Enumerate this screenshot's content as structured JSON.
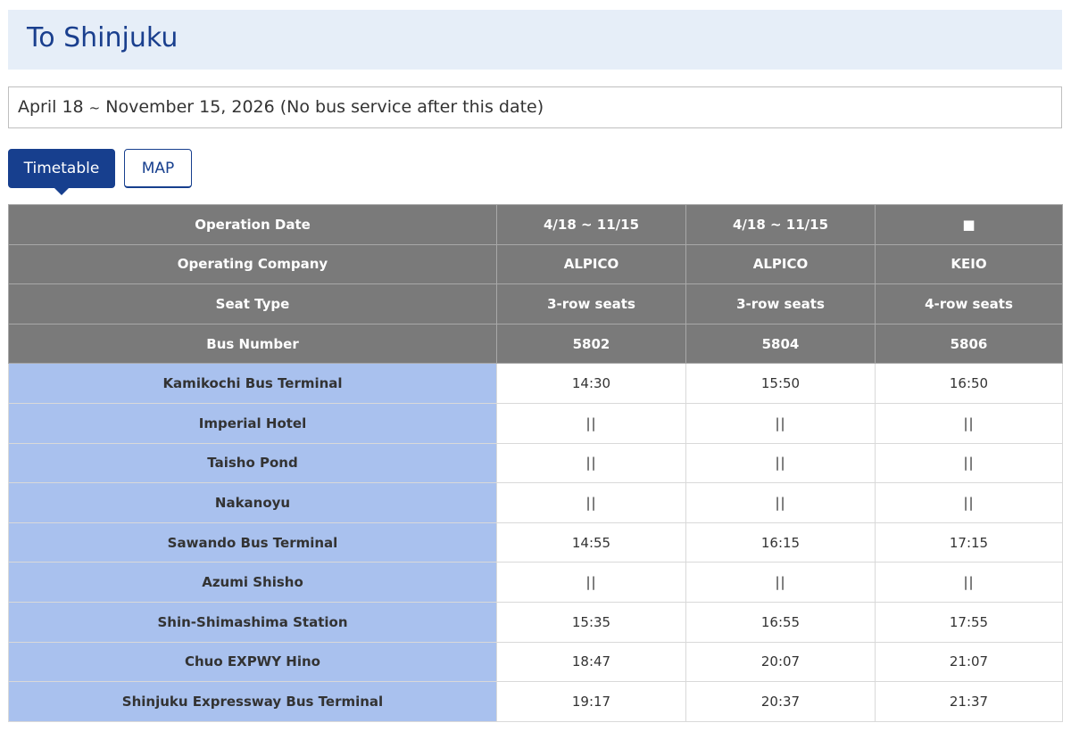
{
  "page": {
    "title": "To Shinjuku",
    "period": {
      "start": "April 18",
      "tilde": "~",
      "end_text": "November 15, 2026 (No bus service after this date)"
    },
    "tabs": [
      {
        "label": "Timetable",
        "active": true
      },
      {
        "label": "MAP",
        "active": false
      }
    ]
  },
  "colors": {
    "accent": "#173f8e",
    "header_bg": "#e6eef8",
    "table_head_bg": "#7a7a7a",
    "stop_bg": "#a9c1ee"
  },
  "table": {
    "header_rows": [
      {
        "label": "Operation Date",
        "values": [
          "4/18 ~ 11/15",
          "4/18 ~ 11/15",
          "■"
        ]
      },
      {
        "label": "Operating Company",
        "values": [
          "ALPICO",
          "ALPICO",
          "KEIO"
        ]
      },
      {
        "label": "Seat Type",
        "values": [
          "3-row seats",
          "3-row seats",
          "4-row seats"
        ]
      },
      {
        "label": "Bus Number",
        "values": [
          "5802",
          "5804",
          "5806"
        ]
      }
    ],
    "stops": [
      {
        "name": "Kamikochi Bus Terminal",
        "times": [
          "14:30",
          "15:50",
          "16:50"
        ]
      },
      {
        "name": "Imperial Hotel",
        "times": [
          "||",
          "||",
          "||"
        ]
      },
      {
        "name": "Taisho Pond",
        "times": [
          "||",
          "||",
          "||"
        ]
      },
      {
        "name": "Nakanoyu",
        "times": [
          "||",
          "||",
          "||"
        ]
      },
      {
        "name": "Sawando Bus Terminal",
        "times": [
          "14:55",
          "16:15",
          "17:15"
        ]
      },
      {
        "name": "Azumi Shisho",
        "times": [
          "||",
          "||",
          "||"
        ]
      },
      {
        "name": "Shin-Shimashima Station",
        "times": [
          "15:35",
          "16:55",
          "17:55"
        ]
      },
      {
        "name": "Chuo EXPWY Hino",
        "times": [
          "18:47",
          "20:07",
          "21:07"
        ]
      },
      {
        "name": "Shinjuku Expressway Bus Terminal",
        "times": [
          "19:17",
          "20:37",
          "21:37"
        ]
      }
    ]
  }
}
